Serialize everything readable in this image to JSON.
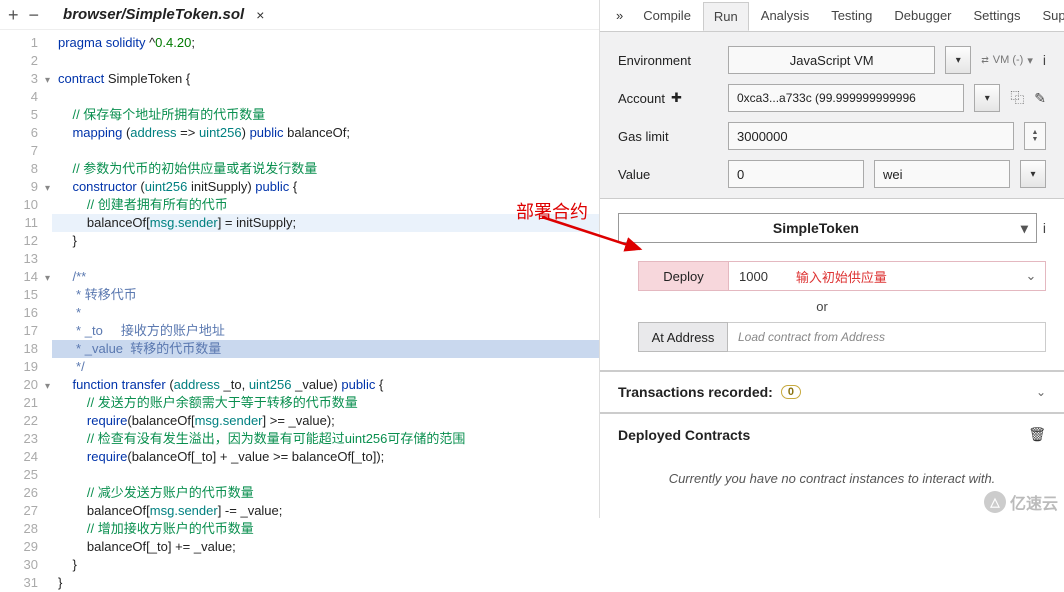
{
  "file_tab": {
    "name": "browser/SimpleToken.sol",
    "close": "×"
  },
  "tab_ops": {
    "plus": "+",
    "minus": "−"
  },
  "top_tabs": {
    "collapse": "»",
    "compile": "Compile",
    "run": "Run",
    "analysis": "Analysis",
    "testing": "Testing",
    "debugger": "Debugger",
    "settings": "Settings",
    "support": "Support"
  },
  "env": {
    "label_env": "Environment",
    "env_value": "JavaScript VM",
    "vm_note": "VM (-)",
    "label_account": "Account",
    "account_value": "0xca3...a733c (99.999999999996",
    "label_gas": "Gas limit",
    "gas_value": "3000000",
    "label_value": "Value",
    "value_amount": "0",
    "unit": "wei"
  },
  "contract": {
    "selected": "SimpleToken",
    "deploy_btn": "Deploy",
    "deploy_val": "1000",
    "deploy_note": "输入初始供应量",
    "or": "or",
    "at_btn": "At Address",
    "at_placeholder": "Load contract from Address"
  },
  "sections": {
    "tx_title": "Transactions recorded:",
    "tx_badge": "0",
    "dep_title": "Deployed Contracts",
    "dep_msg": "Currently you have no contract instances to interact with."
  },
  "annotation": {
    "deploy_label": "部署合约"
  },
  "watermark": "亿速云",
  "code": {
    "lines": [
      {
        "n": 1,
        "c": "",
        "h": "<span class='kw'>pragma</span> <span class='kw'>solidity</span> ^<span class='num'>0.4.20</span>;"
      },
      {
        "n": 2,
        "c": "",
        "h": ""
      },
      {
        "n": 3,
        "c": "chev",
        "h": "<span class='kw'>contract</span> SimpleToken {"
      },
      {
        "n": 4,
        "c": "",
        "h": ""
      },
      {
        "n": 5,
        "c": "",
        "h": "    <span class='cmt'>// 保存每个地址所拥有的代币数量</span>"
      },
      {
        "n": 6,
        "c": "",
        "h": "    <span class='kw'>mapping</span> (<span class='type'>address</span> =&gt; <span class='type'>uint256</span>) <span class='kw'>public</span> balanceOf;"
      },
      {
        "n": 7,
        "c": "",
        "h": ""
      },
      {
        "n": 8,
        "c": "",
        "h": "    <span class='cmt'>// 参数为代币的初始供应量或者说发行数量</span>"
      },
      {
        "n": 9,
        "c": "chev",
        "h": "    <span class='fn'>constructor</span> (<span class='type'>uint256</span> initSupply) <span class='kw'>public</span> {"
      },
      {
        "n": 10,
        "c": "",
        "h": "        <span class='cmt'>// 创建者拥有所有的代币</span>"
      },
      {
        "n": 11,
        "c": "",
        "hl": true,
        "h": "        balanceOf[<span class='type'>msg.sender</span>] = initSupply;"
      },
      {
        "n": 12,
        "c": "",
        "h": "    }"
      },
      {
        "n": 13,
        "c": "",
        "h": ""
      },
      {
        "n": 14,
        "c": "chev",
        "h": "    <span class='doc'>/**</span>"
      },
      {
        "n": 15,
        "c": "",
        "h": "<span class='doc'>     * 转移代币</span>"
      },
      {
        "n": 16,
        "c": "",
        "h": "<span class='doc'>     *</span>"
      },
      {
        "n": 17,
        "c": "",
        "h": "<span class='doc'>     * _to     接收方的账户地址</span>"
      },
      {
        "n": 18,
        "c": "",
        "cursor": true,
        "h": "<span class='doc'>     * _value  转移的代币数量</span>"
      },
      {
        "n": 19,
        "c": "",
        "h": "<span class='doc'>     */</span>"
      },
      {
        "n": 20,
        "c": "chev",
        "h": "    <span class='kw'>function</span> <span class='fn'>transfer</span> (<span class='type'>address</span> _to, <span class='type'>uint256</span> _value) <span class='kw'>public</span> {"
      },
      {
        "n": 21,
        "c": "",
        "h": "        <span class='cmt'>// 发送方的账户余额需大于等于转移的代币数量</span>"
      },
      {
        "n": 22,
        "c": "",
        "h": "        <span class='kw'>require</span>(balanceOf[<span class='type'>msg.sender</span>] &gt;= _value);"
      },
      {
        "n": 23,
        "c": "",
        "h": "        <span class='cmt'>// 检查有没有发生溢出，因为数量有可能超过uint256可存储的范围</span>"
      },
      {
        "n": 24,
        "c": "",
        "h": "        <span class='kw'>require</span>(balanceOf[_to] + _value &gt;= balanceOf[_to]);"
      },
      {
        "n": 25,
        "c": "",
        "h": ""
      },
      {
        "n": 26,
        "c": "",
        "h": "        <span class='cmt'>// 减少发送方账户的代币数量</span>"
      },
      {
        "n": 27,
        "c": "",
        "h": "        balanceOf[<span class='type'>msg.sender</span>] -= _value;"
      },
      {
        "n": 28,
        "c": "",
        "h": "        <span class='cmt'>// 增加接收方账户的代币数量</span>"
      },
      {
        "n": 29,
        "c": "",
        "h": "        balanceOf[_to] += _value;"
      },
      {
        "n": 30,
        "c": "",
        "h": "    }"
      },
      {
        "n": 31,
        "c": "",
        "h": "}"
      }
    ]
  }
}
